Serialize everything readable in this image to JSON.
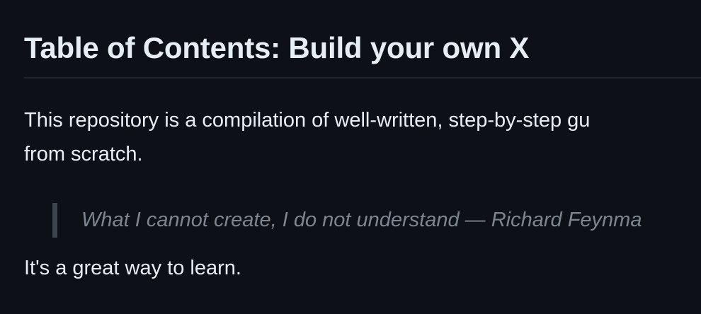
{
  "article": {
    "heading": "Table of Contents: Build your own X",
    "intro_line1": "This repository is a compilation of well-written, step-by-step gu",
    "intro_line2": "from scratch.",
    "quote": "What I cannot create, I do not understand — Richard Feynma",
    "outro": "It's a great way to learn."
  }
}
